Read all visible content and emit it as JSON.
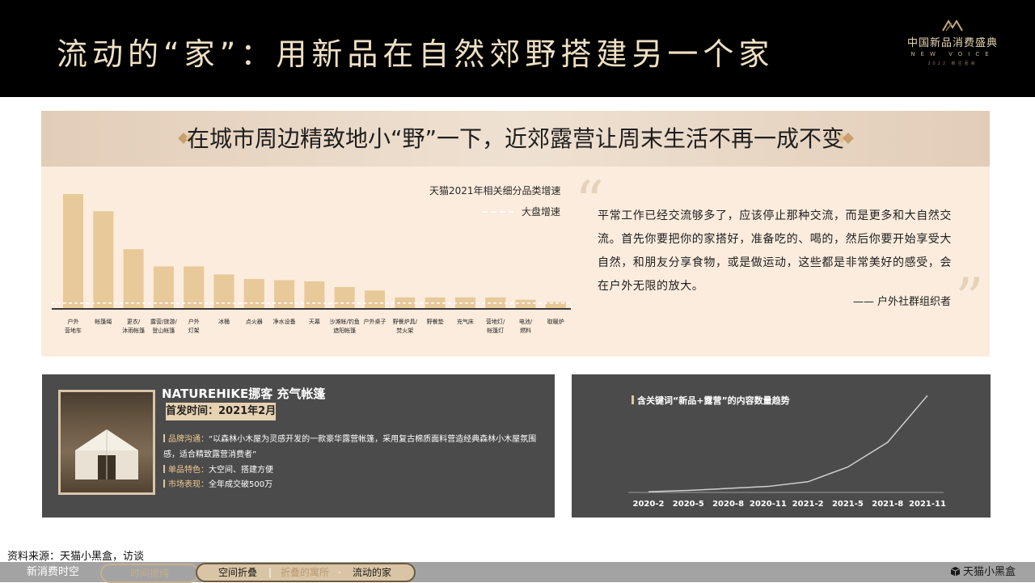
{
  "header": {
    "title": "流动的“家”：用新品在自然郊野搭建另一个家",
    "logo": {
      "name_cn": "中国新品消费盛典",
      "name_en": "NEW VOICE",
      "sub": "2022 新生而来"
    }
  },
  "banner": {
    "text": "在城市周边精致地小“野”一下，近郊露营让周末生活不再一成不变"
  },
  "chart_data": [
    {
      "type": "bar",
      "title": "",
      "legend": [
        "天猫2021年相关细分品类增速",
        "大盘增速"
      ],
      "categories": [
        "户外营地车",
        "帐篷绳",
        "更衣/沐雨帐篷",
        "露营/旅游/登山帐篷",
        "户外灯架",
        "冰桶",
        "点火器",
        "净水设备",
        "天幕",
        "沙滩帐/钓鱼遮阳帐篷",
        "户外桌子",
        "野餐炉具/焚火架",
        "野餐垫",
        "充气床",
        "营地灯/帐篷灯",
        "电池/燃料",
        "取暖炉"
      ],
      "category_lines": [
        [
          "户外",
          "营地车"
        ],
        [
          "帐篷绳"
        ],
        [
          "更衣/",
          "沐雨帐篷"
        ],
        [
          "露营/旅游/",
          "登山帐篷"
        ],
        [
          "户外",
          "灯架"
        ],
        [
          "冰桶"
        ],
        [
          "点火器"
        ],
        [
          "净水设备"
        ],
        [
          "天幕"
        ],
        [
          "沙滩帐/钓鱼",
          "遮阳帐篷"
        ],
        [
          "户外桌子"
        ],
        [
          "野餐炉具/",
          "焚火架"
        ],
        [
          "野餐垫"
        ],
        [
          "充气床"
        ],
        [
          "营地灯/",
          "帐篷灯"
        ],
        [
          "电池/",
          "燃料"
        ],
        [
          "取暖炉"
        ]
      ],
      "values": [
        100,
        85,
        52,
        37,
        37,
        30,
        26,
        25,
        24,
        19,
        16,
        10,
        10,
        10,
        10,
        8,
        6
      ],
      "baseline_value": 5,
      "ylim": [
        0,
        100
      ],
      "grid": false,
      "legend_position": "top-right"
    },
    {
      "type": "line",
      "title": "含关键词“新品+露营”的内容数量趋势",
      "x": [
        "2020-2",
        "2020-5",
        "2020-8",
        "2020-11",
        "2021-2",
        "2021-5",
        "2021-8",
        "2021-11"
      ],
      "y": [
        1,
        3,
        6,
        9,
        16,
        38,
        75,
        145
      ],
      "ylim": [
        0,
        150
      ],
      "grid": false
    }
  ],
  "quote": {
    "text": "平常工作已经交流够多了，应该停止那种交流，而是更多和大自然交流。首先你要把你的家搭好，准备吃的、喝的，然后你要开始享受大自然，和朋友分享食物，或是做运动，这些都是非常美好的感受，会在户外无限的放大。",
    "attribution": "—— 户外社群组织者",
    "open_mark": "“",
    "close_mark": "”"
  },
  "product": {
    "name": "NATUREHIKE挪客 充气帐篷",
    "launch": "首发时间：2021年2月",
    "brand_label": "品牌沟通：",
    "brand_text": "“以森林小木屋为灵感开发的一款豪华露营帐篷，采用复古棉质面料营造经典森林小木屋氛围感，适合精致露营消费者”",
    "features_label": "单品特色：",
    "features_text": "大空间、搭建方便",
    "market_label": "市场表现：",
    "market_text": "全年成交破500万"
  },
  "source": "资料来源：天猫小黑盒，访谈",
  "footer": {
    "label": "新消费时空",
    "nav1": "时间提纯",
    "nav2_a": "空间折叠",
    "nav2_sep": "|",
    "nav2_b": "折叠的寓所",
    "nav2_dot": "·",
    "nav2_c": "流动的家",
    "brand": "天猫小黑盒"
  },
  "colors": {
    "bar": "#e8c999",
    "accent": "#e4c49c",
    "panel": "#fcecdd",
    "card": "#4b4b4b",
    "header": "#000000"
  }
}
